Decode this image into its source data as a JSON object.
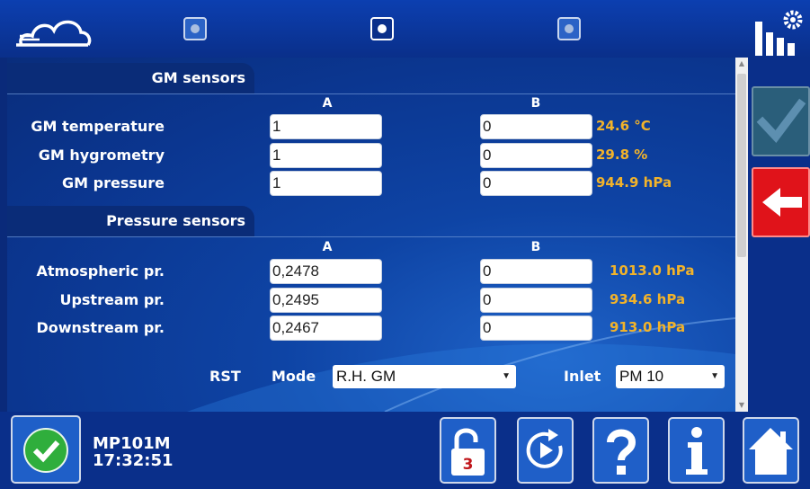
{
  "header": {
    "logo_icon": "cloud-logo-icon",
    "pager": [
      {
        "active": false
      },
      {
        "active": true
      },
      {
        "active": false
      }
    ],
    "stats_icon": "bar-chart-gear-icon"
  },
  "gm_section": {
    "title": "GM sensors",
    "col_a": "A",
    "col_b": "B",
    "rows": [
      {
        "label": "GM temperature",
        "a": "1",
        "b": "0",
        "reading": "24.6 °C"
      },
      {
        "label": "GM hygrometry",
        "a": "1",
        "b": "0",
        "reading": "29.8 %"
      },
      {
        "label": "GM pressure",
        "a": "1",
        "b": "0",
        "reading": "944.9 hPa"
      }
    ]
  },
  "pressure_section": {
    "title": "Pressure sensors",
    "col_a": "A",
    "col_b": "B",
    "rows": [
      {
        "label": "Atmospheric pr.",
        "a": "0,2478",
        "b": "0",
        "reading": "1013.0 hPa"
      },
      {
        "label": "Upstream pr.",
        "a": "0,2495",
        "b": "0",
        "reading": "934.6 hPa"
      },
      {
        "label": "Downstream pr.",
        "a": "0,2467",
        "b": "0",
        "reading": "913.0 hPa"
      }
    ]
  },
  "rst": {
    "label": "RST",
    "mode_label": "Mode",
    "mode_value": "R.H. GM",
    "inlet_label": "Inlet",
    "inlet_value": "PM 10"
  },
  "side": {
    "validate_icon": "checkmark-icon",
    "back_icon": "back-arrow-icon"
  },
  "footer": {
    "status_icon": "status-ok-icon",
    "instrument": "MP101M",
    "time": "17:32:51",
    "lock_level": "3",
    "buttons": [
      "unlock-icon",
      "replay-icon",
      "help-icon",
      "info-icon",
      "home-icon"
    ]
  },
  "colors": {
    "background": "#0a2f8a",
    "reading": "#f2b32a",
    "back_button": "#e0131a",
    "status_ok": "#2fae3c"
  }
}
